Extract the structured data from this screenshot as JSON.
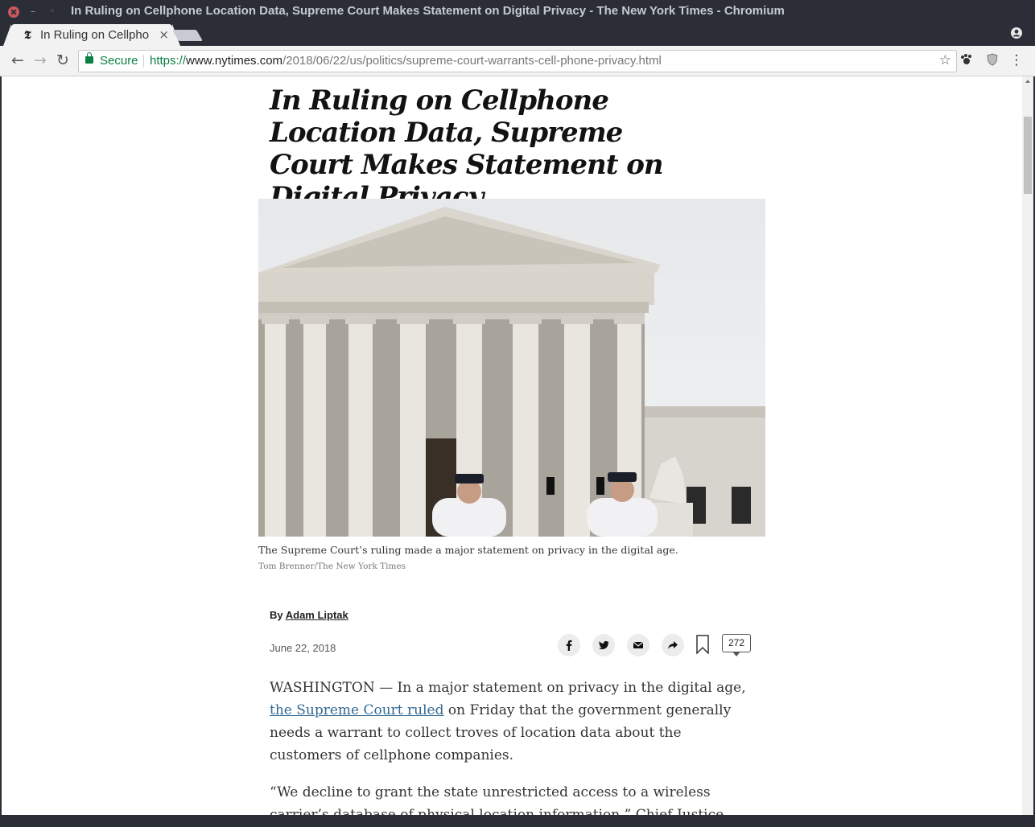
{
  "window": {
    "title": "In Ruling on Cellphone Location Data, Supreme Court Makes Statement on Digital Privacy - The New York Times - Chromium"
  },
  "tab": {
    "favicon": "𝕿",
    "title": "In Ruling on Cellphone Location Data, Supreme Court Makes Statement on Digital Privacy",
    "close": "×"
  },
  "toolbar": {
    "back": "←",
    "forward": "→",
    "reload": "↻",
    "secure_label": "Secure",
    "url_scheme": "https://",
    "url_host": "www.nytimes.com",
    "url_path": "/2018/06/22/us/politics/supreme-court-warrants-cell-phone-privacy.html",
    "star": "☆",
    "menu": "⋮"
  },
  "article": {
    "headline": "In Ruling on Cellphone Location Data, Supreme Court Makes Statement on Digital Privacy",
    "caption": "The Supreme Court’s ruling made a major statement on privacy in the digital age.",
    "credit": "Tom Brenner/The New York Times",
    "byline_prefix": "By ",
    "author": "Adam Liptak",
    "date": "June 22, 2018",
    "comment_count": "272",
    "p1_before": "WASHINGTON — In a major statement on privacy in the digital age, ",
    "p1_link": "the Supreme Court ruled",
    "p1_after": " on Friday that the government generally needs a warrant to collect troves of location data about the customers of cellphone companies.",
    "p2": "“We decline to grant the state unrestricted access to a wireless carrier’s database of physical location information,” Chief Justice John G. Roberts"
  },
  "icons": {
    "share": [
      "facebook-icon",
      "twitter-icon",
      "email-icon",
      "share-icon"
    ],
    "bookmark": "bookmark-icon",
    "comments": "comment-icon"
  }
}
